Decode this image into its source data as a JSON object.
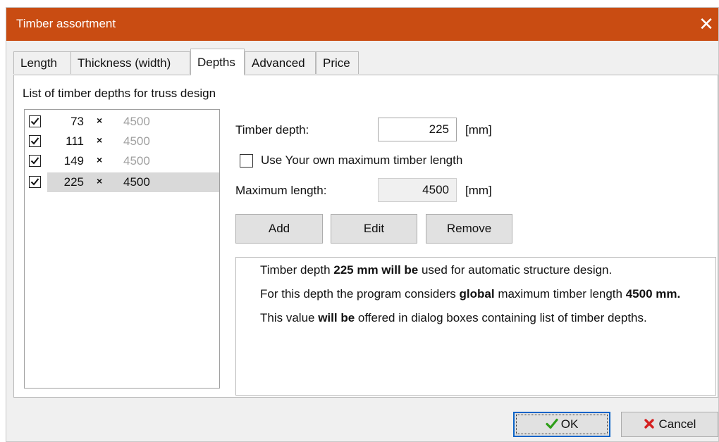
{
  "window": {
    "title": "Timber assortment",
    "close_glyph": "✕"
  },
  "tabs": [
    {
      "label": "Length"
    },
    {
      "label": "Thickness (width)"
    },
    {
      "label": "Depths"
    },
    {
      "label": "Advanced"
    },
    {
      "label": "Price"
    }
  ],
  "panel": {
    "list_label": "List of timber depths for truss design",
    "rows": [
      {
        "checked": true,
        "depth": "73",
        "sep": "×",
        "length": "4500",
        "selected": false
      },
      {
        "checked": true,
        "depth": "111",
        "sep": "×",
        "length": "4500",
        "selected": false
      },
      {
        "checked": true,
        "depth": "149",
        "sep": "×",
        "length": "4500",
        "selected": false
      },
      {
        "checked": true,
        "depth": "225",
        "sep": "×",
        "length": "4500",
        "selected": true
      }
    ],
    "timber_depth_label": "Timber depth:",
    "timber_depth_value": "225",
    "timber_depth_unit": "[mm]",
    "own_max_label": "Use Your own maximum timber length",
    "own_max_checked": false,
    "max_length_label": "Maximum length:",
    "max_length_value": "4500",
    "max_length_unit": "[mm]",
    "buttons": {
      "add": "Add",
      "edit": "Edit",
      "remove": "Remove"
    },
    "info": {
      "p1_a": "Timber depth ",
      "p1_b": "225 mm will be",
      "p1_c": " used for automatic structure design.",
      "p2_a": "For this depth the program considers ",
      "p2_b": "global",
      "p2_c": " maximum timber length ",
      "p2_d": "4500 mm.",
      "p3_a": "This value ",
      "p3_b": "will be",
      "p3_c": " offered in dialog boxes containing list of timber depths."
    }
  },
  "footer": {
    "ok_label": "OK",
    "cancel_label": "Cancel",
    "ok_icon": "check-icon",
    "cancel_icon": "x-icon"
  },
  "colors": {
    "titlebar": "#c94c12",
    "ok_check": "#2f9e1a",
    "cancel_x": "#d42020"
  }
}
